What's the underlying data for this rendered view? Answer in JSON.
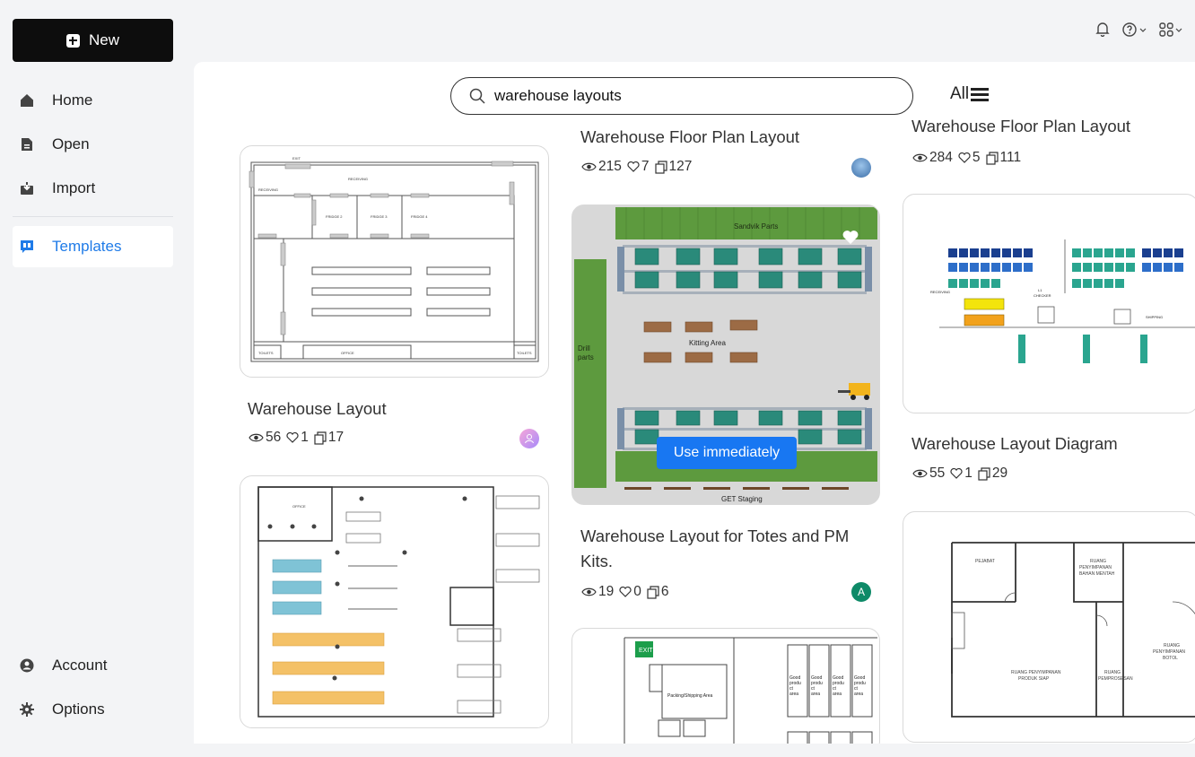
{
  "sidebar": {
    "new_label": "New",
    "items": [
      {
        "label": "Home",
        "icon": "home-icon"
      },
      {
        "label": "Open",
        "icon": "file-icon"
      },
      {
        "label": "Import",
        "icon": "import-icon"
      },
      {
        "label": "Templates",
        "icon": "templates-icon",
        "active": true
      }
    ],
    "bottom_items": [
      {
        "label": "Account",
        "icon": "account-icon"
      },
      {
        "label": "Options",
        "icon": "gear-icon"
      }
    ]
  },
  "search": {
    "value": "warehouse layouts",
    "placeholder": ""
  },
  "filter_label": "All",
  "accent_color": "#1877f2",
  "templates": [
    {
      "title": "Warehouse Layout",
      "views": "56",
      "likes": "1",
      "copies": "17"
    },
    {
      "title": "Warehouse Floor Plan Layout",
      "views": "215",
      "likes": "7",
      "copies": "127"
    },
    {
      "title": "Warehouse Layout for Totes and PM Kits.",
      "views": "19",
      "likes": "0",
      "copies": "6",
      "avatar_letter": "A"
    },
    {
      "title": "Warehouse Floor Plan Layout",
      "views": "284",
      "likes": "5",
      "copies": "111"
    },
    {
      "title": "Warehouse Layout Diagram",
      "views": "55",
      "likes": "1",
      "copies": "29"
    }
  ],
  "preview_text": {
    "sandvik": "Sandvik Parts",
    "kitting": "Kitting Area",
    "drill": "Drill parts",
    "get_staging": "GET Staging",
    "use_button": "Use immediately",
    "office": "OFFICE",
    "toilets": "TOILETS",
    "exit": "EXIT",
    "pejabat": "PEJABAT",
    "packing": "Packing/Shipping Area",
    "good_product": "Good product area"
  }
}
